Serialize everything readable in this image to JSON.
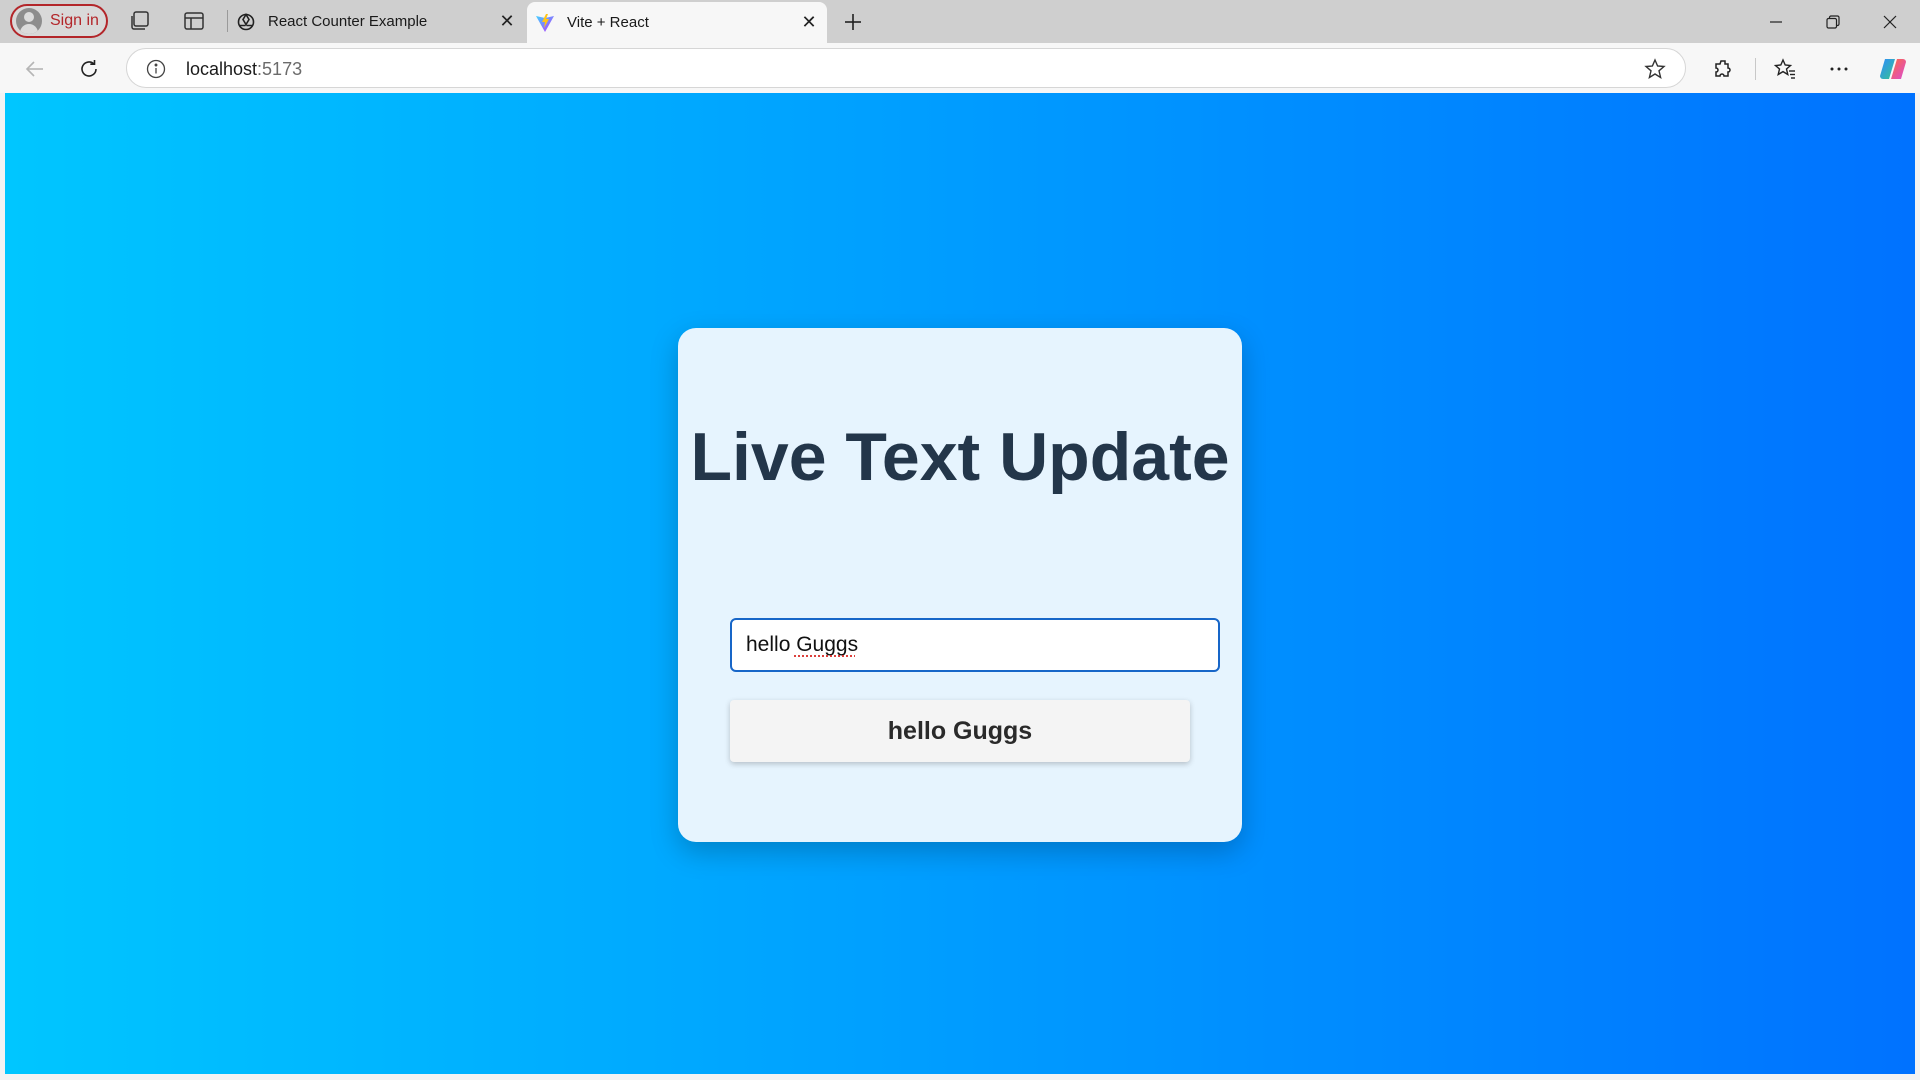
{
  "browser": {
    "sign_in_label": "Sign in",
    "tabs": [
      {
        "title": "React Counter Example",
        "favicon": "openai-logo-icon",
        "active": false
      },
      {
        "title": "Vite + React",
        "favicon": "vite-logo-icon",
        "active": true
      }
    ],
    "address": {
      "host": "localhost",
      "port": ":5173"
    }
  },
  "page": {
    "title": "Live Text Update",
    "input_value": "hello Guggs",
    "output_text": "hello Guggs",
    "gradient": [
      "#00c6ff",
      "#0072ff"
    ],
    "card_bg": "#e6f4fe",
    "title_color": "#23364a"
  }
}
